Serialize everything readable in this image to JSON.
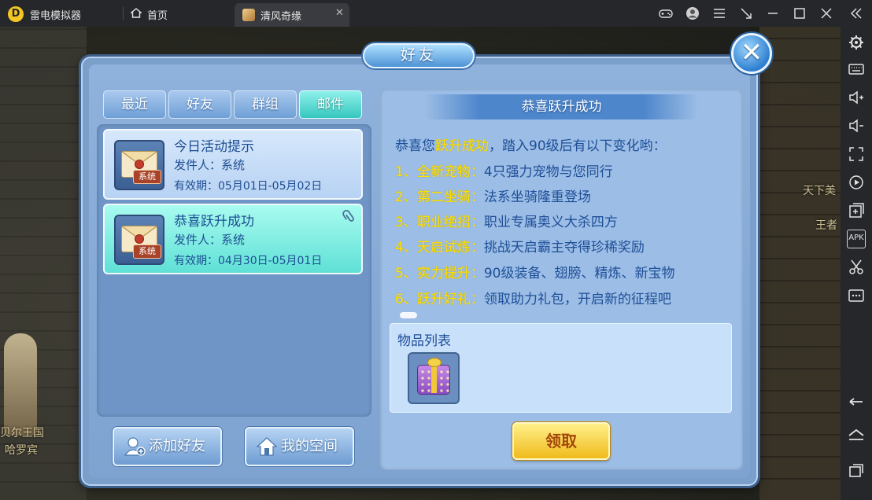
{
  "titlebar": {
    "app_name": "雷电模拟器",
    "home_tab": "首页",
    "game_tab": "清风奇缘",
    "close_symbol": "✕"
  },
  "background": {
    "left_text_1": "贝尔王国",
    "left_text_2": "哈罗宾",
    "right_text_1": "天下美",
    "right_text_2": "王者"
  },
  "dialog": {
    "title": "好友",
    "tabs": [
      "最近",
      "好友",
      "群组",
      "邮件"
    ],
    "active_tab": "邮件",
    "mails": [
      {
        "title": "今日活动提示",
        "sender": "发件人：系统",
        "validity": "有效期：05月01日-05月02日",
        "tag": "系统",
        "has_attachment": false
      },
      {
        "title": "恭喜跃升成功",
        "sender": "发件人：系统",
        "validity": "有效期：04月30日-05月01日",
        "tag": "系统",
        "has_attachment": true
      }
    ],
    "buttons": {
      "add_friend": "添加好友",
      "my_space": "我的空间"
    },
    "content": {
      "header": "恭喜跃升成功",
      "intro_prefix": "恭喜您",
      "intro_highlight": "跃升成功",
      "intro_suffix": "，踏入90级后有以下变化哟：",
      "lines": [
        {
          "key": "1、全新宠物：",
          "value": "4只强力宠物与您同行"
        },
        {
          "key": "2、第二坐骑：",
          "value": "法系坐骑隆重登场"
        },
        {
          "key": "3、职业绝招：",
          "value": "职业专属奥义大杀四方"
        },
        {
          "key": "4、天启试炼：",
          "value": "挑战天启霸主夺得珍稀奖励"
        },
        {
          "key": "5、实力提升：",
          "value": "90级装备、翅膀、精炼、新宝物"
        },
        {
          "key": "6、跃升好礼：",
          "value": "领取助力礼包，开启新的征程吧"
        }
      ],
      "items_title": "物品列表",
      "claim_button": "领取"
    }
  },
  "colors": {
    "highlight": "#ffe200",
    "text_blue": "#1e4f98",
    "active_tab": "#35c7bf",
    "claim_button": "#f0bb1c"
  }
}
